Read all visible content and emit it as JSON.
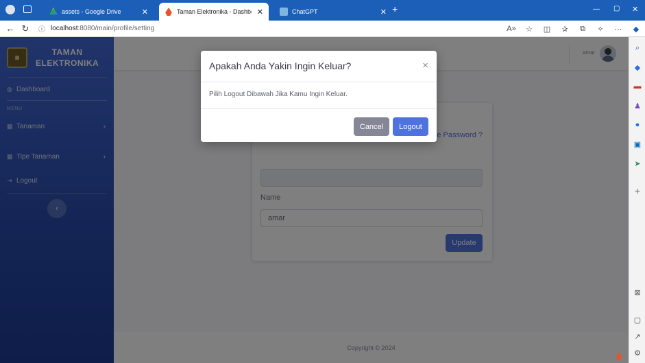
{
  "browser": {
    "tabs": [
      {
        "label": "assets - Google Drive",
        "active": false
      },
      {
        "label": "Taman Elektronika - Dashboard",
        "active": true
      },
      {
        "label": "ChatGPT",
        "active": false
      }
    ],
    "new_tab": "+",
    "url_host": "localhost",
    "url_path": ":8080/main/profile/setting",
    "window_controls": [
      "—",
      "▢",
      "✕"
    ]
  },
  "sidebar": {
    "brand_line1": "TAMAN",
    "brand_line2": "ELEKTRONIKA",
    "dashboard": "Dashboard",
    "heading": "MENU",
    "items": [
      {
        "label": "Tanaman"
      },
      {
        "label": "Tipe Tanaman"
      }
    ],
    "logout": "Logout",
    "toggle": "‹"
  },
  "topbar": {
    "username": "amar"
  },
  "profile_card": {
    "link": "e Password ?",
    "name_label": "Name",
    "name_value": "amar",
    "update_label": "Update"
  },
  "footer": {
    "copyright": "Copyright © 2024"
  },
  "modal": {
    "title": "Apakah Anda Yakin Ingin Keluar?",
    "close": "×",
    "body": "Pilih Logout Dibawah Jika Kamu Ingin Keluar.",
    "cancel": "Cancel",
    "logout": "Logout"
  },
  "colors": {
    "primary": "#4e73df",
    "secondary": "#858796",
    "tabbar": "#1c5fb8"
  }
}
